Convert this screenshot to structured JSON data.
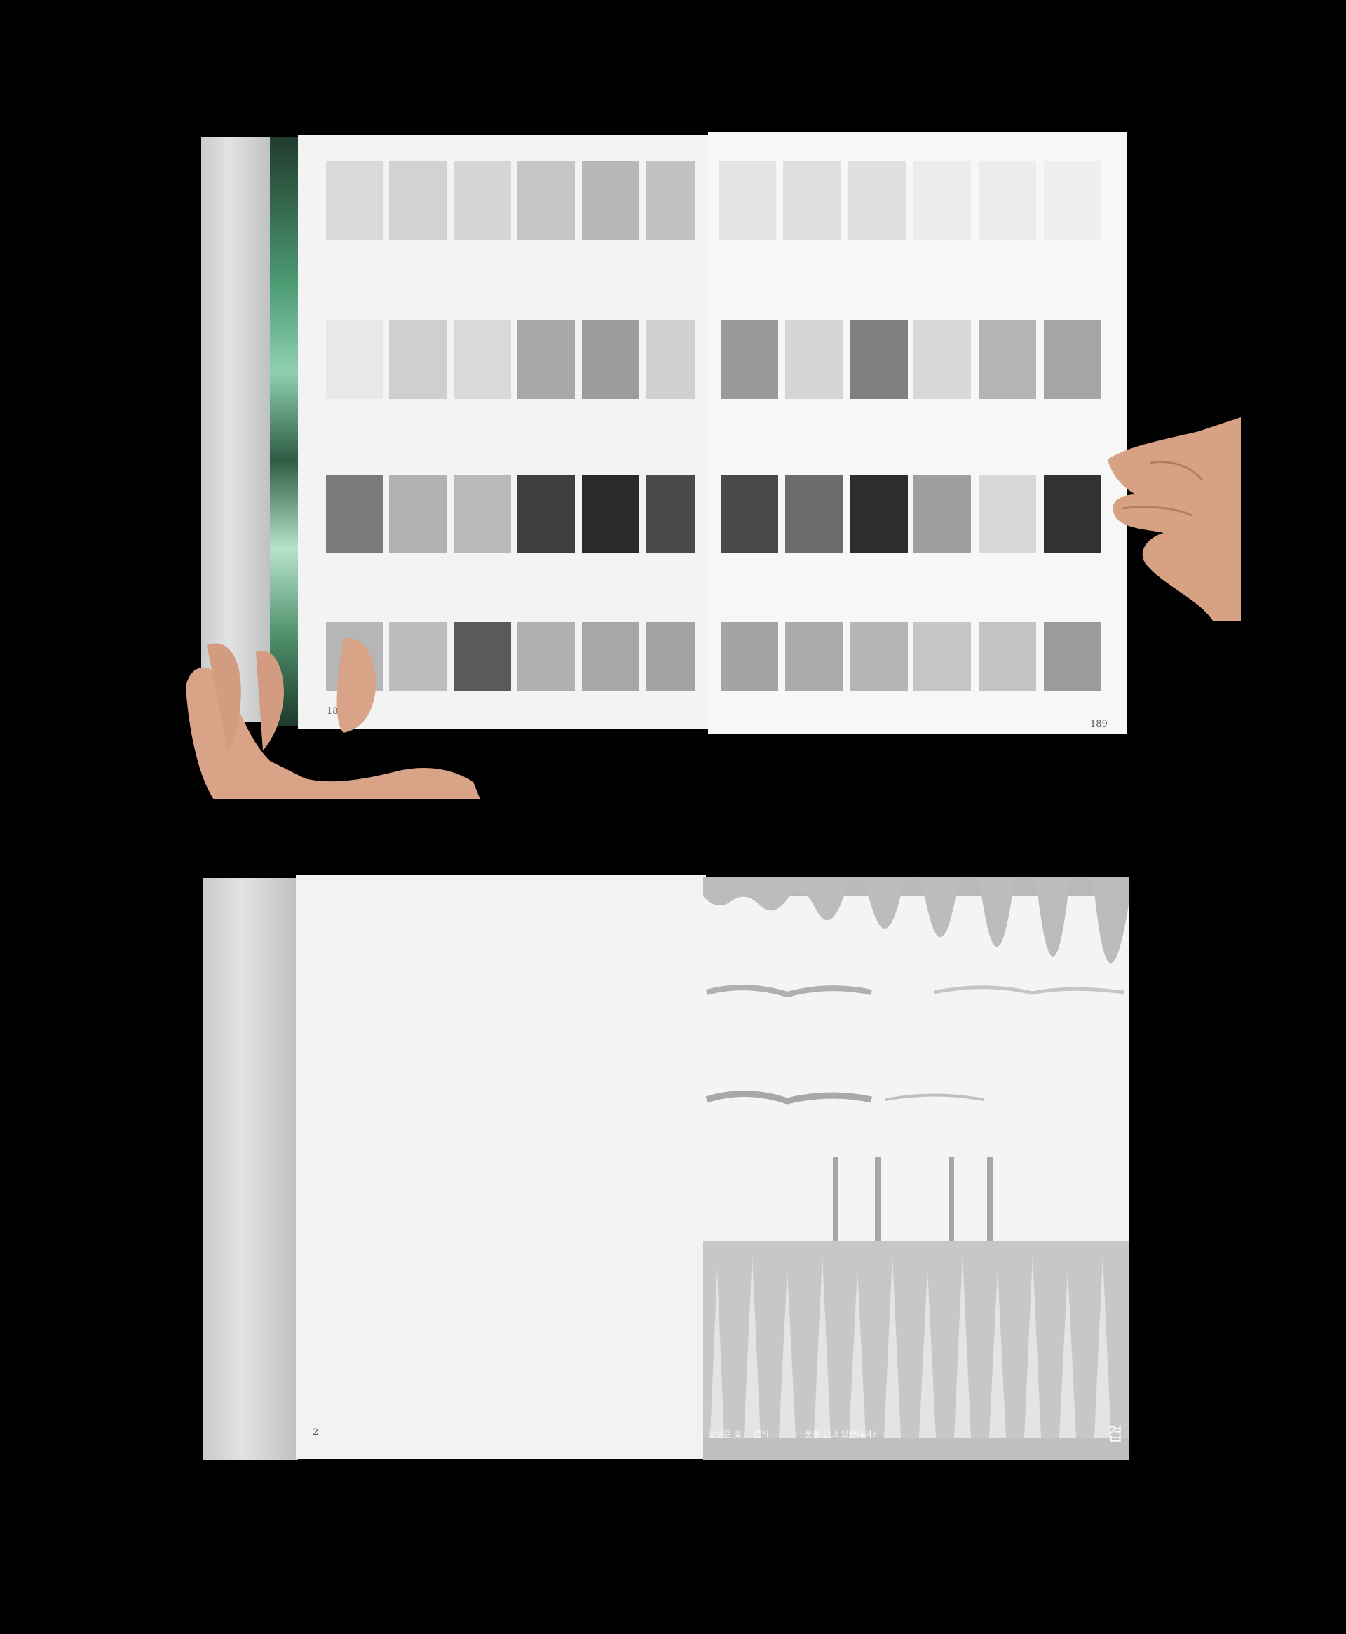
{
  "spread_top": {
    "left_page_number": "188",
    "right_page_number": "189"
  },
  "spread_bottom": {
    "left_page_number": "2",
    "caption_part1": "당신은 몇",
    "caption_part2": "겹의",
    "caption_part3": "옷을 입고 있습니까?",
    "big_char": "겹"
  }
}
